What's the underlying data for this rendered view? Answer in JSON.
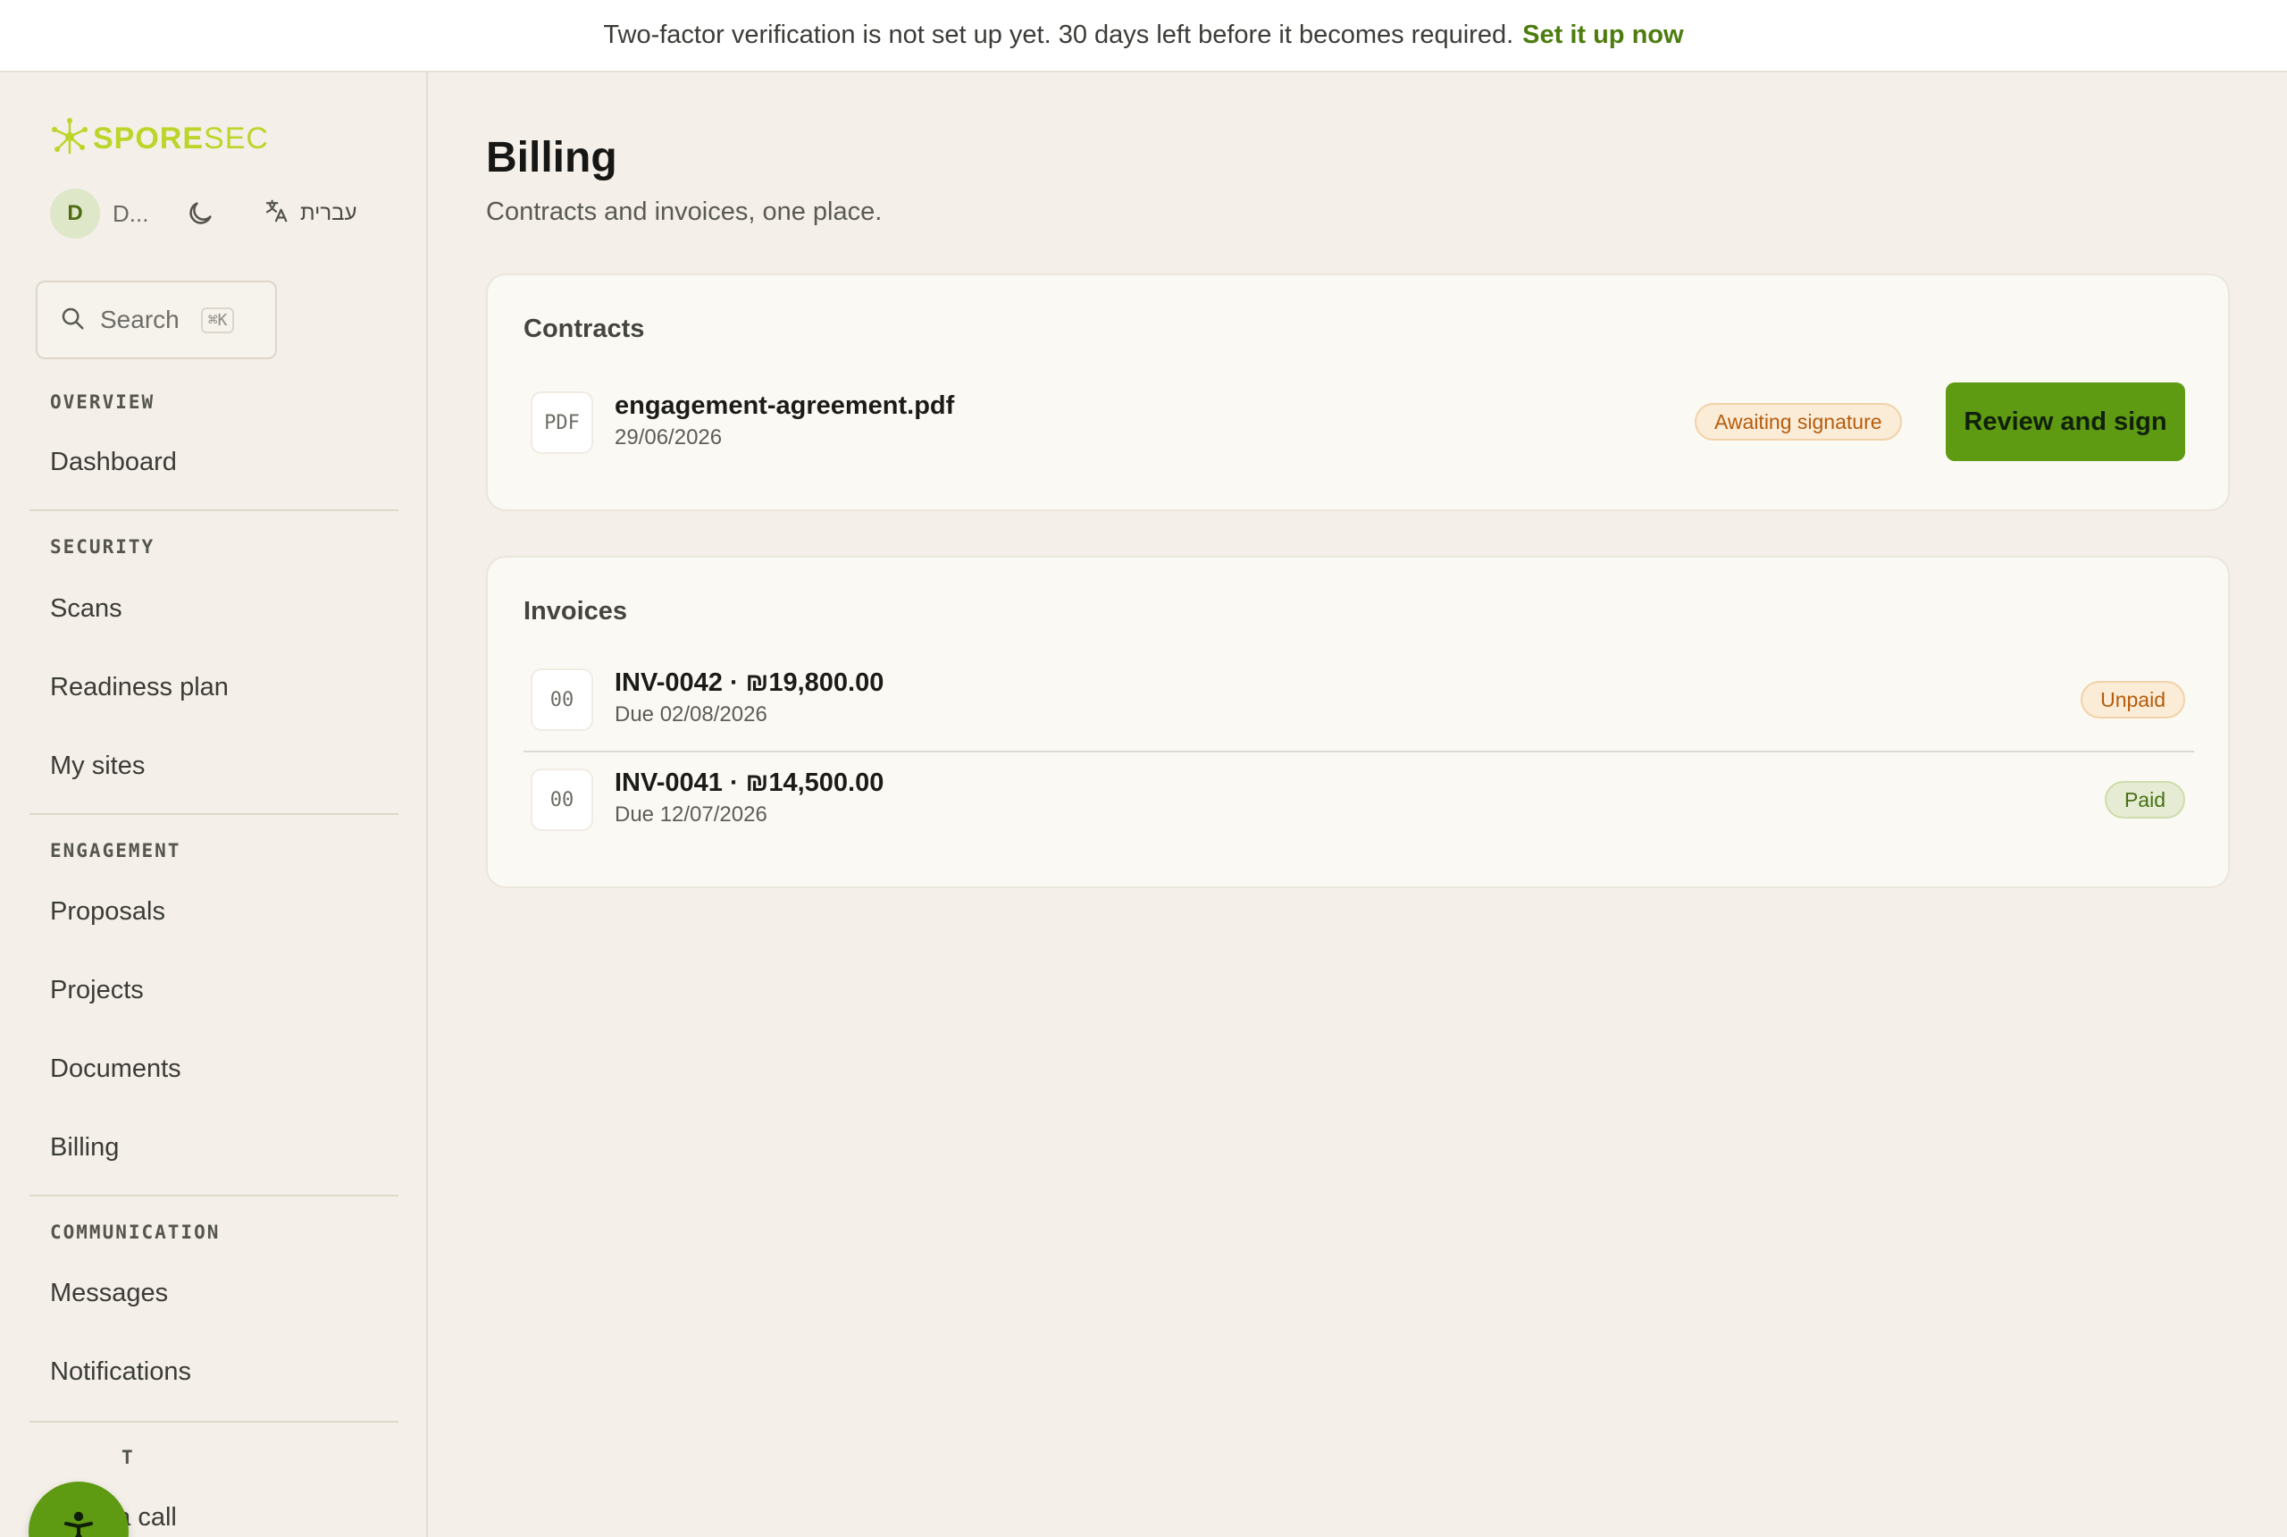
{
  "banner": {
    "message": "Two-factor verification is not set up yet. 30 days left before it becomes required.",
    "link": "Set it up now"
  },
  "sidebar": {
    "logo": {
      "part1": "SPORE",
      "part2": "SEC"
    },
    "user": {
      "initial": "D",
      "name": "D..."
    },
    "language": "עברית",
    "search": {
      "label": "Search",
      "shortcut": "⌘K"
    },
    "sections": {
      "overview": {
        "title": "OVERVIEW",
        "items": [
          "Dashboard"
        ]
      },
      "security": {
        "title": "SECURITY",
        "items": [
          "Scans",
          "Readiness plan",
          "My sites"
        ]
      },
      "engagement": {
        "title": "ENGAGEMENT",
        "items": [
          "Proposals",
          "Projects",
          "Documents",
          "Billing"
        ]
      },
      "communication": {
        "title": "COMMUNICATION",
        "items": [
          "Messages",
          "Notifications"
        ]
      },
      "support": {
        "title": "T",
        "items": [
          "Book a call"
        ]
      }
    }
  },
  "main": {
    "title": "Billing",
    "subtitle": "Contracts and invoices, one place.",
    "contracts": {
      "title": "Contracts",
      "items": [
        {
          "icon_label": "PDF",
          "name": "engagement-agreement.pdf",
          "date": "29/06/2026",
          "status": "Awaiting signature",
          "action": "Review and sign"
        }
      ]
    },
    "invoices": {
      "title": "Invoices",
      "items": [
        {
          "icon_label": "00",
          "title": "INV-0042 · ₪19,800.00",
          "due": "Due 02/08/2026",
          "status": "Unpaid"
        },
        {
          "icon_label": "00",
          "title": "INV-0041 · ₪14,500.00",
          "due": "Due 12/07/2026",
          "status": "Paid"
        }
      ]
    }
  },
  "colors": {
    "accent": "#5e9a12",
    "link": "#4d7c0f",
    "logo": "#bcd52a",
    "badge_amber": "#b65c0c",
    "badge_green": "#467015",
    "background": "#f4efe8"
  },
  "icons": [
    "spore-logo-icon",
    "moon-icon",
    "translate-icon",
    "search-icon",
    "accessibility-icon"
  ]
}
